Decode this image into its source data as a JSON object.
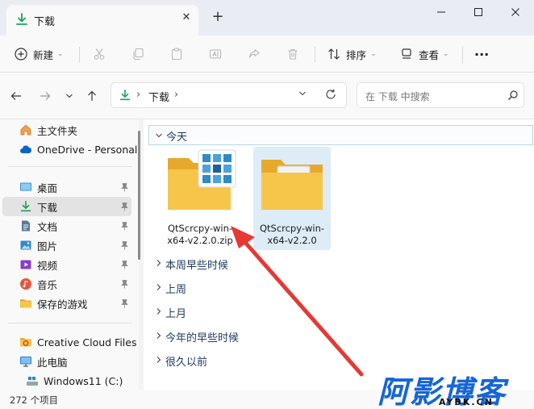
{
  "window": {
    "tab_title": "下载",
    "tab_close": "✕",
    "new_tab": "+"
  },
  "toolbar": {
    "new_label": "新建",
    "sort_label": "排序",
    "view_label": "查看",
    "more_label": "···"
  },
  "address": {
    "folder": "下载",
    "separator": "›"
  },
  "search": {
    "placeholder": "在 下载 中搜索"
  },
  "sidebar": {
    "items": [
      {
        "label": "主文件夹",
        "icon": "home-icon"
      },
      {
        "label": "OneDrive - Personal",
        "icon": "cloud-icon"
      },
      {
        "label": "桌面",
        "icon": "desktop-icon",
        "pinned": true
      },
      {
        "label": "下载",
        "icon": "download-icon",
        "pinned": true,
        "selected": true
      },
      {
        "label": "文档",
        "icon": "document-icon",
        "pinned": true
      },
      {
        "label": "图片",
        "icon": "picture-icon",
        "pinned": true
      },
      {
        "label": "视频",
        "icon": "video-icon",
        "pinned": true
      },
      {
        "label": "音乐",
        "icon": "music-icon",
        "pinned": true
      },
      {
        "label": "保存的游戏",
        "icon": "folder-icon",
        "pinned": true
      },
      {
        "label": "Creative Cloud Files",
        "icon": "creative-cloud-icon"
      },
      {
        "label": "此电脑",
        "icon": "computer-icon"
      },
      {
        "label": "Windows11 (C:)",
        "icon": "drive-icon"
      }
    ]
  },
  "groups": {
    "today": "今天",
    "this_week_earlier": "本周早些时候",
    "last_week": "上周",
    "last_month": "上月",
    "earlier_this_year": "今年的早些时候",
    "long_ago": "很久以前"
  },
  "files": [
    {
      "name_line1": "QtScrcpy-win-",
      "name_line2": "x64-v2.2.0.zip",
      "icon": "zip-folder-icon"
    },
    {
      "name_line1": "QtScrcpy-win-",
      "name_line2": "x64-v2.2.0",
      "icon": "folder-icon",
      "selected": true
    }
  ],
  "status": {
    "item_count": "272 个项目"
  },
  "watermark": {
    "brand": "阿影博客",
    "domain": "AYBK.CN"
  },
  "colors": {
    "accent": "#0067c0",
    "folder": "#f6c64b",
    "selection": "#ddecf7",
    "arrow": "#e53935"
  }
}
